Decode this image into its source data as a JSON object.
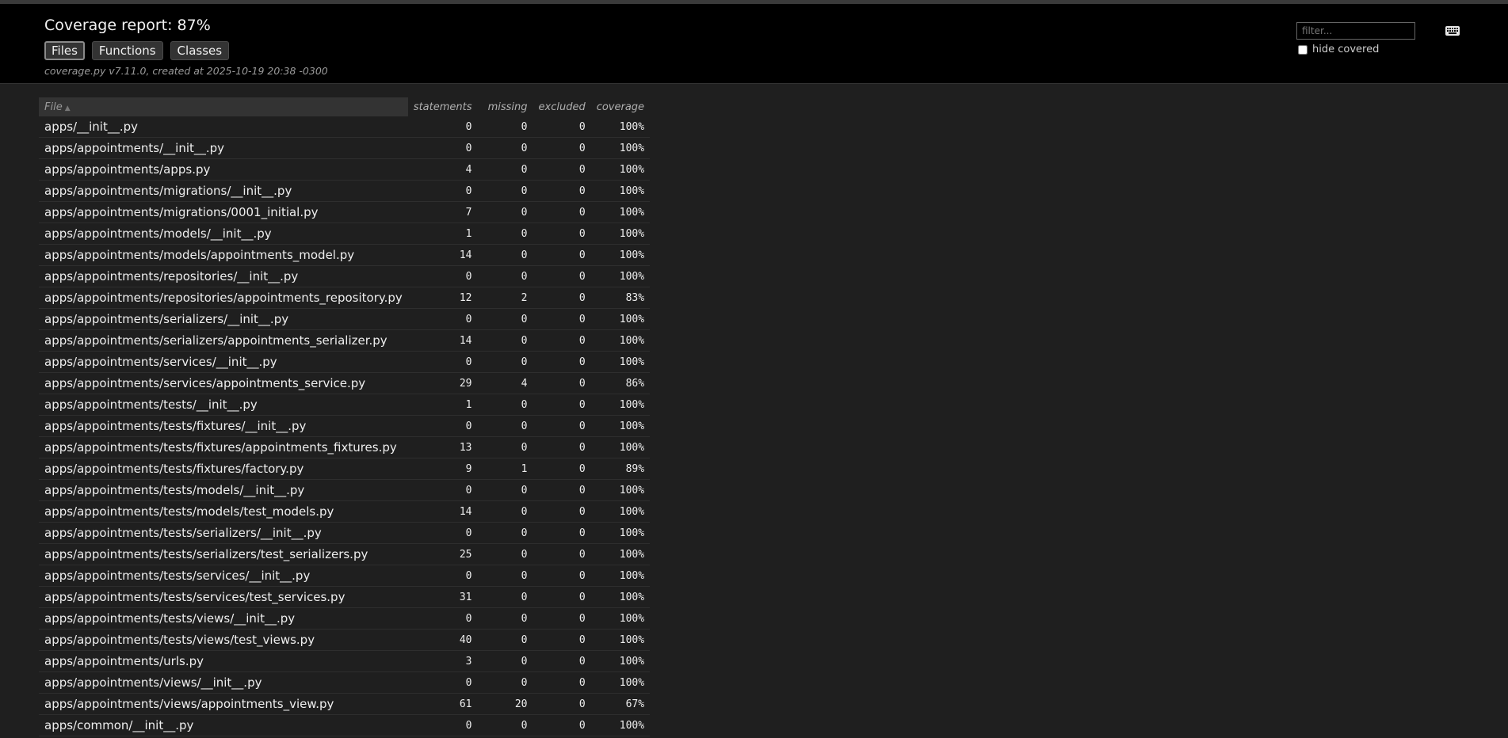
{
  "header": {
    "title": "Coverage report: 87%",
    "tabs": [
      {
        "label": "Files",
        "current": true
      },
      {
        "label": "Functions",
        "current": false
      },
      {
        "label": "Classes",
        "current": false
      }
    ],
    "meta": "coverage.py v7.11.0, created at 2025-10-19 20:38 -0300",
    "filter": {
      "placeholder": "filter...",
      "value": ""
    },
    "hide_covered_label": "hide covered",
    "hide_covered_checked": false,
    "keyboard_icon": "keyboard-icon"
  },
  "table": {
    "columns": {
      "file": "File",
      "statements": "statements",
      "missing": "missing",
      "excluded": "excluded",
      "coverage": "coverage"
    },
    "sort": {
      "column": "File",
      "direction": "ascending",
      "icon": "sort-up-arrow-icon"
    },
    "rows": [
      {
        "file": "apps/__init__.py",
        "statements": "0",
        "missing": "0",
        "excluded": "0",
        "coverage": "100%"
      },
      {
        "file": "apps/appointments/__init__.py",
        "statements": "0",
        "missing": "0",
        "excluded": "0",
        "coverage": "100%"
      },
      {
        "file": "apps/appointments/apps.py",
        "statements": "4",
        "missing": "0",
        "excluded": "0",
        "coverage": "100%"
      },
      {
        "file": "apps/appointments/migrations/__init__.py",
        "statements": "0",
        "missing": "0",
        "excluded": "0",
        "coverage": "100%"
      },
      {
        "file": "apps/appointments/migrations/0001_initial.py",
        "statements": "7",
        "missing": "0",
        "excluded": "0",
        "coverage": "100%"
      },
      {
        "file": "apps/appointments/models/__init__.py",
        "statements": "1",
        "missing": "0",
        "excluded": "0",
        "coverage": "100%"
      },
      {
        "file": "apps/appointments/models/appointments_model.py",
        "statements": "14",
        "missing": "0",
        "excluded": "0",
        "coverage": "100%"
      },
      {
        "file": "apps/appointments/repositories/__init__.py",
        "statements": "0",
        "missing": "0",
        "excluded": "0",
        "coverage": "100%"
      },
      {
        "file": "apps/appointments/repositories/appointments_repository.py",
        "statements": "12",
        "missing": "2",
        "excluded": "0",
        "coverage": "83%"
      },
      {
        "file": "apps/appointments/serializers/__init__.py",
        "statements": "0",
        "missing": "0",
        "excluded": "0",
        "coverage": "100%"
      },
      {
        "file": "apps/appointments/serializers/appointments_serializer.py",
        "statements": "14",
        "missing": "0",
        "excluded": "0",
        "coverage": "100%"
      },
      {
        "file": "apps/appointments/services/__init__.py",
        "statements": "0",
        "missing": "0",
        "excluded": "0",
        "coverage": "100%"
      },
      {
        "file": "apps/appointments/services/appointments_service.py",
        "statements": "29",
        "missing": "4",
        "excluded": "0",
        "coverage": "86%"
      },
      {
        "file": "apps/appointments/tests/__init__.py",
        "statements": "1",
        "missing": "0",
        "excluded": "0",
        "coverage": "100%"
      },
      {
        "file": "apps/appointments/tests/fixtures/__init__.py",
        "statements": "0",
        "missing": "0",
        "excluded": "0",
        "coverage": "100%"
      },
      {
        "file": "apps/appointments/tests/fixtures/appointments_fixtures.py",
        "statements": "13",
        "missing": "0",
        "excluded": "0",
        "coverage": "100%"
      },
      {
        "file": "apps/appointments/tests/fixtures/factory.py",
        "statements": "9",
        "missing": "1",
        "excluded": "0",
        "coverage": "89%"
      },
      {
        "file": "apps/appointments/tests/models/__init__.py",
        "statements": "0",
        "missing": "0",
        "excluded": "0",
        "coverage": "100%"
      },
      {
        "file": "apps/appointments/tests/models/test_models.py",
        "statements": "14",
        "missing": "0",
        "excluded": "0",
        "coverage": "100%"
      },
      {
        "file": "apps/appointments/tests/serializers/__init__.py",
        "statements": "0",
        "missing": "0",
        "excluded": "0",
        "coverage": "100%"
      },
      {
        "file": "apps/appointments/tests/serializers/test_serializers.py",
        "statements": "25",
        "missing": "0",
        "excluded": "0",
        "coverage": "100%"
      },
      {
        "file": "apps/appointments/tests/services/__init__.py",
        "statements": "0",
        "missing": "0",
        "excluded": "0",
        "coverage": "100%"
      },
      {
        "file": "apps/appointments/tests/services/test_services.py",
        "statements": "31",
        "missing": "0",
        "excluded": "0",
        "coverage": "100%"
      },
      {
        "file": "apps/appointments/tests/views/__init__.py",
        "statements": "0",
        "missing": "0",
        "excluded": "0",
        "coverage": "100%"
      },
      {
        "file": "apps/appointments/tests/views/test_views.py",
        "statements": "40",
        "missing": "0",
        "excluded": "0",
        "coverage": "100%"
      },
      {
        "file": "apps/appointments/urls.py",
        "statements": "3",
        "missing": "0",
        "excluded": "0",
        "coverage": "100%"
      },
      {
        "file": "apps/appointments/views/__init__.py",
        "statements": "0",
        "missing": "0",
        "excluded": "0",
        "coverage": "100%"
      },
      {
        "file": "apps/appointments/views/appointments_view.py",
        "statements": "61",
        "missing": "20",
        "excluded": "0",
        "coverage": "67%"
      },
      {
        "file": "apps/common/__init__.py",
        "statements": "0",
        "missing": "0",
        "excluded": "0",
        "coverage": "100%"
      }
    ]
  }
}
